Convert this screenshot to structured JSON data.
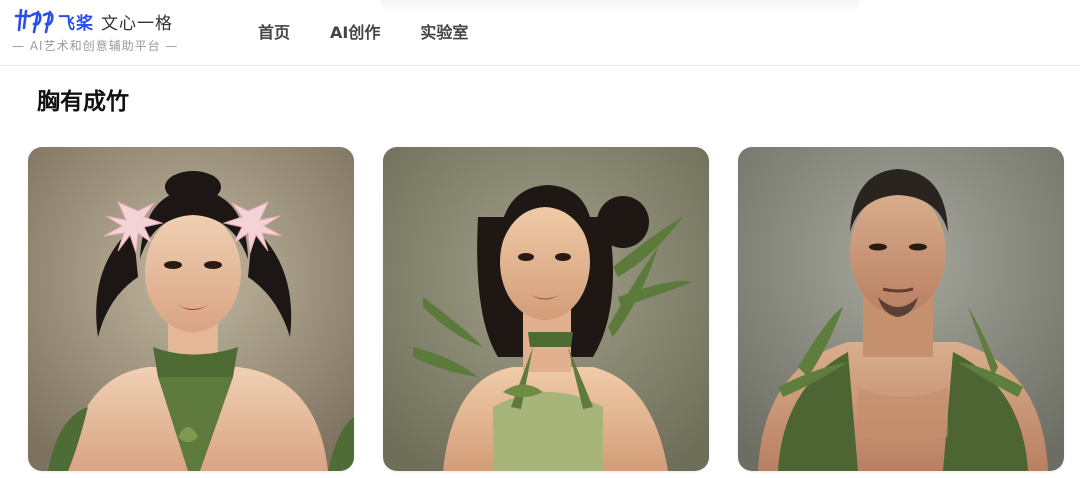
{
  "header": {
    "logo_mark": "卝",
    "brand": "飞桨",
    "product": "文心一格",
    "tagline": "— AI艺术和创意辅助平台 —",
    "nav": [
      {
        "label": "首页"
      },
      {
        "label": "AI创作"
      },
      {
        "label": "实验室"
      }
    ]
  },
  "section": {
    "title": "胸有成竹"
  },
  "gallery": [
    {
      "subject": "woman with bamboo leaves and pink flowers in hair",
      "bg": "#a49b86"
    },
    {
      "subject": "woman with bamboo halter and bamboo plant",
      "bg": "#8b8a72"
    },
    {
      "subject": "man with bamboo leaf vest",
      "bg": "#8c8d80"
    }
  ],
  "colors": {
    "brand": "#2b4ee8",
    "bamboo_green": "#5e7a3c",
    "skin": "#e3b591",
    "hair": "#1c1614"
  },
  "icons": [
    "logo-icon"
  ]
}
